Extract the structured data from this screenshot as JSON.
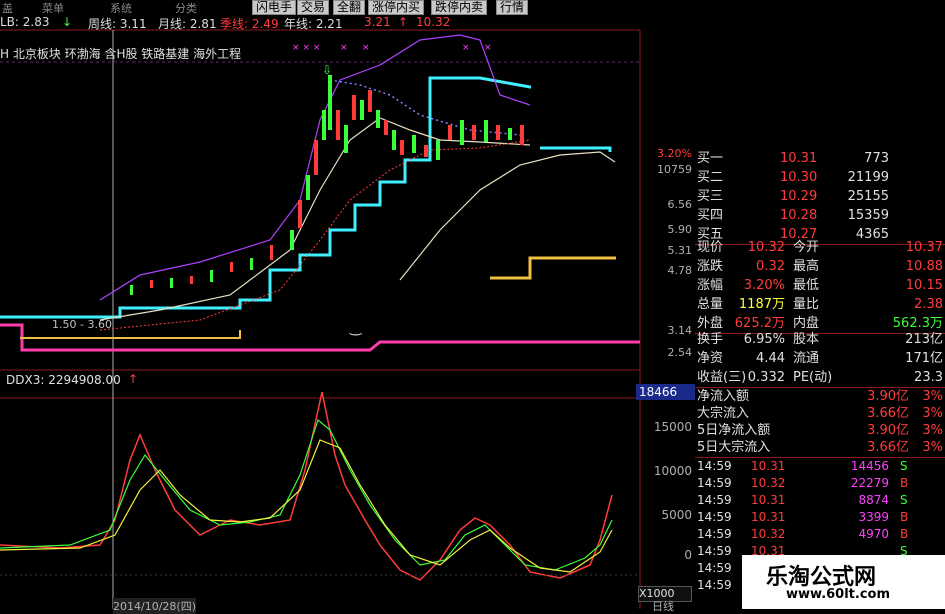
{
  "menu": {
    "items": [
      "盖",
      "菜单",
      "系统",
      "分类"
    ]
  },
  "tabs": [
    {
      "label": "闪电手"
    },
    {
      "label": "交易"
    },
    {
      "label": "全翻"
    },
    {
      "label": "涨停内买"
    },
    {
      "label": "跌停内卖"
    },
    {
      "label": "行情"
    }
  ],
  "ma_line": {
    "lb": "LB: 2.83",
    "lb_arrow": "↓",
    "week": "周线: 3.11",
    "month": "月线: 2.81",
    "quarter": "季线: 2.49",
    "year": "年线: 2.21",
    "extra": "3.21",
    "up_arrow": "↑",
    "extra2": "10.32"
  },
  "concepts": "H 北京板块 环渤海 含H股 铁路基建 海外工程",
  "price_scale": [
    "3.20%",
    "10759",
    "6.56",
    "5.90",
    "5.31",
    "4.78",
    "3.14",
    "2.54"
  ],
  "price_label_inline": "1.50 - 3.60",
  "ddx": {
    "title": "DDX3: 2294908.00",
    "arrow": "↑",
    "badge": "18466",
    "scale": [
      "15000",
      "10000",
      "5000",
      "0"
    ],
    "multiplier": "X1000"
  },
  "colors": {
    "bg": "#000000",
    "up": "#ff3c3c",
    "down": "#3cff3c",
    "cyan": "#40f0ff",
    "magenta": "#ff3caa",
    "gold": "#f0c040",
    "purple": "#b040ff"
  },
  "order_book": [
    {
      "label": "买一",
      "price": "10.31",
      "vol": "773"
    },
    {
      "label": "买二",
      "price": "10.30",
      "vol": "21199"
    },
    {
      "label": "买三",
      "price": "10.29",
      "vol": "25155"
    },
    {
      "label": "买四",
      "price": "10.28",
      "vol": "15359"
    },
    {
      "label": "买五",
      "price": "10.27",
      "vol": "4365"
    }
  ],
  "quote": [
    {
      "l1": "现价",
      "v1": "10.32",
      "l2": "今开",
      "v2": "10.37"
    },
    {
      "l1": "涨跌",
      "v1": "0.32",
      "l2": "最高",
      "v2": "10.88"
    },
    {
      "l1": "涨幅",
      "v1": "3.20%",
      "l2": "最低",
      "v2": "10.15"
    },
    {
      "l1": "总量",
      "v1": "1187万",
      "l2": "量比",
      "v2": "2.38"
    },
    {
      "l1": "外盘",
      "v1": "625.2万",
      "l2": "内盘",
      "v2": "562.3万"
    }
  ],
  "stats": [
    {
      "l1": "换手",
      "v1": "6.95%",
      "l2": "股本",
      "v2": "213亿"
    },
    {
      "l1": "净资",
      "v1": "4.44",
      "l2": "流通",
      "v2": "171亿"
    },
    {
      "l1": "收益(三)",
      "v1": "0.332",
      "l2": "PE(动)",
      "v2": "23.3"
    }
  ],
  "flows": [
    {
      "label": "净流入额",
      "value": "3.90亿",
      "pct": "3%"
    },
    {
      "label": "大宗流入",
      "value": "3.66亿",
      "pct": "3%"
    },
    {
      "label": "5日净流入额",
      "value": "3.90亿",
      "pct": "3%"
    },
    {
      "label": "5日大宗流入",
      "value": "3.66亿",
      "pct": "3%"
    }
  ],
  "ticks": [
    {
      "time": "14:59",
      "price": "10.31",
      "vol": "14456",
      "side": "S"
    },
    {
      "time": "14:59",
      "price": "10.32",
      "vol": "22279",
      "side": "B"
    },
    {
      "time": "14:59",
      "price": "10.31",
      "vol": "8874",
      "side": "S"
    },
    {
      "time": "14:59",
      "price": "10.31",
      "vol": "3399",
      "side": "B"
    },
    {
      "time": "14:59",
      "price": "10.32",
      "vol": "4970",
      "side": "B"
    },
    {
      "time": "14:59",
      "price": "10.31",
      "vol": "",
      "side": "S"
    },
    {
      "time": "14:59",
      "price": "",
      "vol": "",
      "side": ""
    },
    {
      "time": "14:59",
      "price": "",
      "vol": "",
      "side": ""
    }
  ],
  "bottom_axis": {
    "date_label": "2014/10/28(四)",
    "right_label": "日线"
  },
  "watermark": {
    "title": "乐淘公式网",
    "url": "www.60lt.com"
  }
}
